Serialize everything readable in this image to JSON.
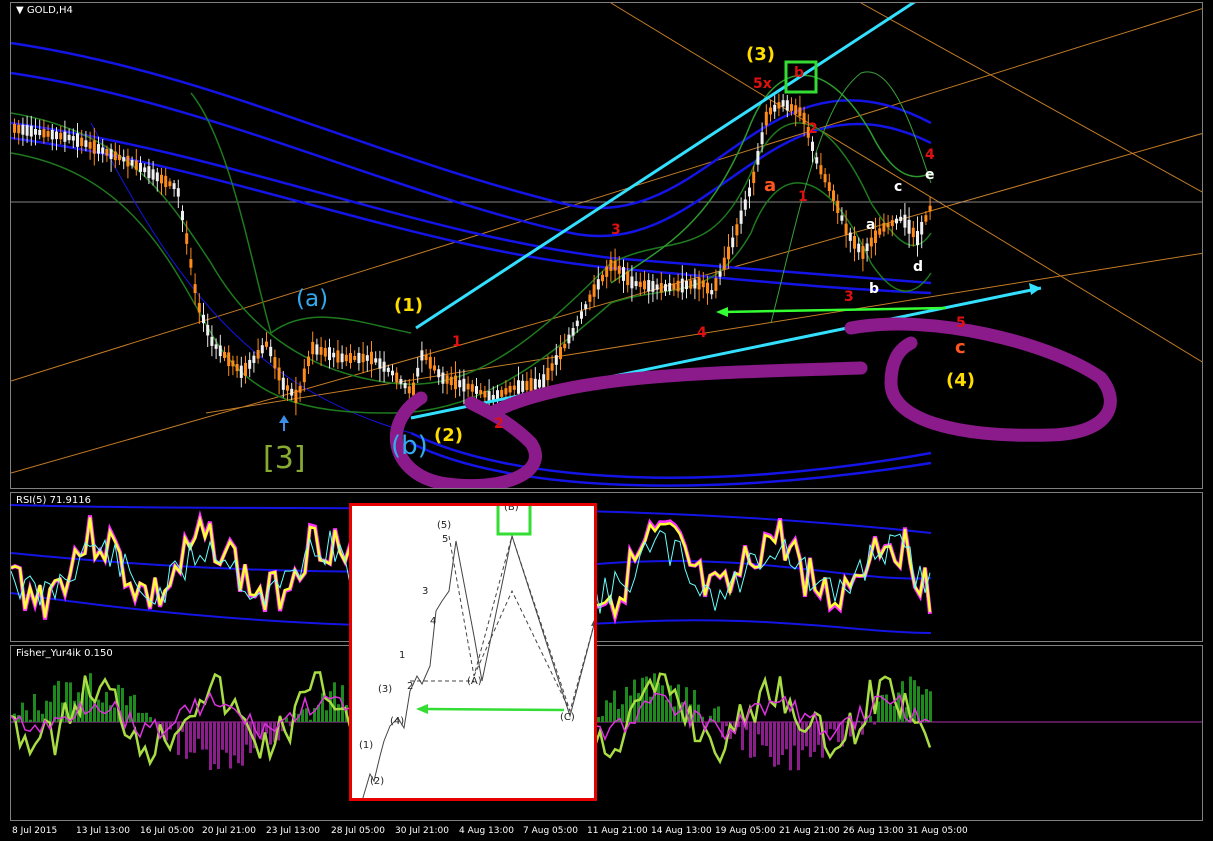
{
  "main_chart": {
    "title": "GOLD,H4",
    "wave_labels": {
      "a_bracket": "(a)",
      "b_bracket": "(b)",
      "three_square": "[3]",
      "one_paren": "(1)",
      "two_paren": "(2)",
      "three_paren": "(3)",
      "four_paren": "(4)",
      "red_1": "1",
      "red_2": "2",
      "red_3": "3",
      "red_4": "4",
      "red_5x": "5x",
      "red_b": "b",
      "red_2b": "2",
      "red_1b": "1",
      "red_a": "a",
      "red_4b": "4",
      "red_3b": "3",
      "red_5": "5",
      "red_c": "c",
      "white_a": "a",
      "white_b": "b",
      "white_c": "c",
      "white_d": "d",
      "white_e": "e"
    },
    "colors": {
      "bullish_candle": "#ff8c1a",
      "envelope_blue": "#1414e6",
      "envelope_green": "#1e7a1e",
      "cyan_trendline": "#33e0ff",
      "purple_drawing": "#8b1a8b",
      "green_arrow": "#33ff33"
    }
  },
  "rsi_panel": {
    "title": "RSI(5) 71.9116"
  },
  "fisher_panel": {
    "title": "Fisher_Yur4ik 0.150"
  },
  "inset_diagram": {
    "labels": {
      "p1": "(1)",
      "p2": "(2)",
      "p3": "(3)",
      "p4": "(4)",
      "p5": "(5)",
      "n1": "1",
      "n2": "2",
      "n3": "3",
      "n4": "4",
      "n5": "5",
      "A": "(A)",
      "B": "(B)",
      "C": "(C)"
    }
  },
  "x_axis": {
    "ticks": [
      "8 Jul 2015",
      "13 Jul 13:00",
      "16 Jul 05:00",
      "20 Jul 21:00",
      "23 Jul 13:00",
      "28 Jul 05:00",
      "30 Jul 21:00",
      "4 Aug 13:00",
      "7 Aug 05:00",
      "11 Aug 21:00",
      "14 Aug 13:00",
      "19 Aug 05:00",
      "21 Aug 21:00",
      "26 Aug 13:00",
      "31 Aug 05:00"
    ]
  }
}
